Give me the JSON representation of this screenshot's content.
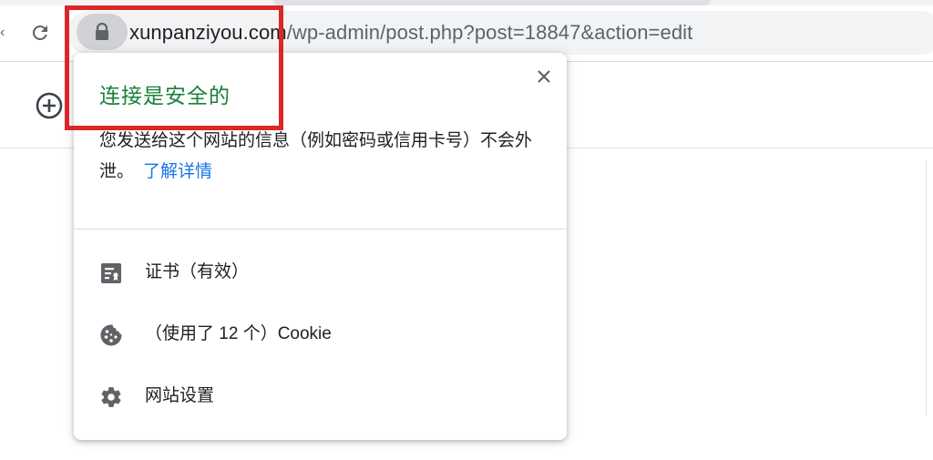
{
  "browser": {
    "url_host": "xunpanziyou.com",
    "url_path": "/wp-admin/post.php?post=18847&action=edit",
    "reload_icon": "reload-icon",
    "lock_icon": "lock-icon"
  },
  "page": {
    "add_icon": "add-circle-icon"
  },
  "site_info_popup": {
    "title": "连接是安全的",
    "description": "您发送给这个网站的信息（例如密码或信用卡号）不会外泄。",
    "learn_more": "了解详情",
    "close_icon": "close-icon",
    "items": [
      {
        "icon": "certificate-icon",
        "label": "证书（有效）"
      },
      {
        "icon": "cookie-icon",
        "label": "（使用了 12 个）Cookie"
      },
      {
        "icon": "gear-icon",
        "label": "网站设置"
      }
    ],
    "title_color": "#188038",
    "link_color": "#1a73e8"
  },
  "annotation": {
    "highlight_color": "#d9272a"
  }
}
